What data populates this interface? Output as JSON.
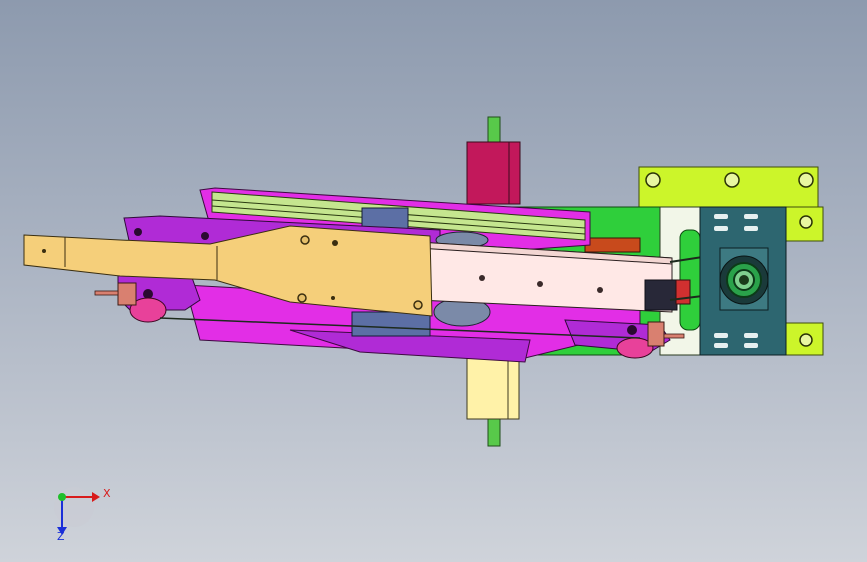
{
  "viewport": {
    "background_top": "#8d9aae",
    "background_bottom": "#cfd3da"
  },
  "triad": {
    "x_label": "X",
    "z_label": "Z",
    "x_color": "#d81b1b",
    "y_color": "#1fbf2a",
    "z_color": "#1a2fd8"
  },
  "parts": [
    {
      "name": "arm-plate",
      "color": "#f5cf7a"
    },
    {
      "name": "base-frame",
      "color": "#e22ee6"
    },
    {
      "name": "side-frame-purple",
      "color": "#b02bd6"
    },
    {
      "name": "motor-plate",
      "color": "#ccf52a"
    },
    {
      "name": "motor-housing",
      "color": "#2d6670"
    },
    {
      "name": "carriage-block",
      "color": "#ffe8e6"
    },
    {
      "name": "clamp-block",
      "color": "#c2185b"
    },
    {
      "name": "bracket-yellow",
      "color": "#fff2a8"
    },
    {
      "name": "shaft",
      "color": "#58c94a"
    },
    {
      "name": "rail-green",
      "color": "#c5e68f"
    },
    {
      "name": "side-plate-green",
      "color": "#2fcf3b"
    },
    {
      "name": "slider-blue",
      "color": "#5c6fa5"
    },
    {
      "name": "roller-pink",
      "color": "#e8419a"
    },
    {
      "name": "sensor-orange",
      "color": "#c84a1c"
    },
    {
      "name": "connector-salmon",
      "color": "#d98070"
    }
  ]
}
